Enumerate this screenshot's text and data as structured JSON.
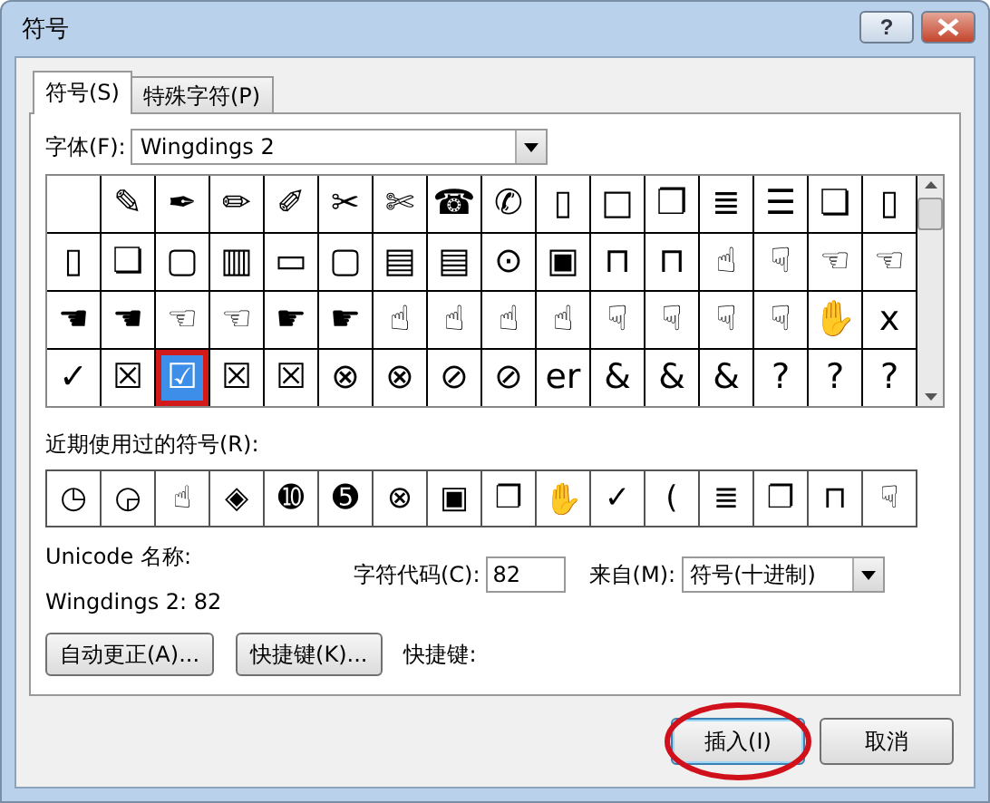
{
  "window": {
    "title": "符号",
    "help": "?"
  },
  "tabs": [
    {
      "label": "符号(S)",
      "selected": true
    },
    {
      "label": "特殊字符(P)",
      "selected": false
    }
  ],
  "font": {
    "label": "字体(F):",
    "value": "Wingdings 2"
  },
  "symbols": [
    [
      {
        "selected": false
      },
      {
        "glyph": "✎",
        "selected": false
      },
      {
        "glyph": "✒",
        "selected": false
      },
      {
        "glyph": "✏",
        "selected": false
      },
      {
        "glyph": "✐",
        "selected": false
      },
      {
        "glyph": "✂",
        "selected": false
      },
      {
        "glyph": "✄",
        "selected": false
      },
      {
        "glyph": "☎",
        "selected": false
      },
      {
        "glyph": "✆",
        "selected": false
      },
      {
        "glyph": "▯",
        "selected": false
      },
      {
        "glyph": "□",
        "selected": false
      },
      {
        "glyph": "❐",
        "selected": false
      },
      {
        "glyph": "≣",
        "selected": false
      },
      {
        "glyph": "☰",
        "selected": false
      },
      {
        "glyph": "❏",
        "selected": false
      },
      {
        "glyph": "▯",
        "selected": false
      }
    ],
    [
      {
        "glyph": "▯",
        "selected": false
      },
      {
        "glyph": "❏",
        "selected": false
      },
      {
        "glyph": "▢",
        "selected": false
      },
      {
        "glyph": "▥",
        "selected": false
      },
      {
        "glyph": "▭",
        "selected": false
      },
      {
        "glyph": "▢",
        "selected": false
      },
      {
        "glyph": "▤",
        "selected": false
      },
      {
        "glyph": "▤",
        "selected": false
      },
      {
        "glyph": "⊙",
        "selected": false
      },
      {
        "glyph": "▣",
        "selected": false
      },
      {
        "glyph": "⊓",
        "selected": false
      },
      {
        "glyph": "⊓",
        "selected": false
      },
      {
        "glyph": "☝",
        "selected": false
      },
      {
        "glyph": "☟",
        "selected": false
      },
      {
        "glyph": "☜",
        "selected": false
      },
      {
        "glyph": "☜",
        "selected": false
      }
    ],
    [
      {
        "glyph": "☚",
        "selected": false
      },
      {
        "glyph": "☚",
        "selected": false
      },
      {
        "glyph": "☜",
        "selected": false
      },
      {
        "glyph": "☜",
        "selected": false
      },
      {
        "glyph": "☛",
        "selected": false
      },
      {
        "glyph": "☛",
        "selected": false
      },
      {
        "glyph": "☝",
        "selected": false
      },
      {
        "glyph": "☝",
        "selected": false
      },
      {
        "glyph": "☝",
        "selected": false
      },
      {
        "glyph": "☝",
        "selected": false
      },
      {
        "glyph": "☟",
        "selected": false
      },
      {
        "glyph": "☟",
        "selected": false
      },
      {
        "glyph": "☟",
        "selected": false
      },
      {
        "glyph": "☟",
        "selected": false
      },
      {
        "glyph": "✋",
        "selected": false
      },
      {
        "glyph": "x",
        "selected": false
      }
    ],
    [
      {
        "glyph": "✓",
        "selected": false
      },
      {
        "glyph": "☒",
        "selected": false
      },
      {
        "glyph": "☑",
        "selected": true
      },
      {
        "glyph": "☒",
        "selected": false
      },
      {
        "glyph": "☒",
        "selected": false
      },
      {
        "glyph": "⊗",
        "selected": false
      },
      {
        "glyph": "⊗",
        "selected": false
      },
      {
        "glyph": "⊘",
        "selected": false
      },
      {
        "glyph": "⊘",
        "selected": false
      },
      {
        "glyph": "er",
        "selected": false
      },
      {
        "glyph": "&",
        "selected": false
      },
      {
        "glyph": "&",
        "selected": false
      },
      {
        "glyph": "&",
        "selected": false
      },
      {
        "glyph": "?",
        "selected": false
      },
      {
        "glyph": "?",
        "selected": false
      },
      {
        "glyph": "?",
        "selected": false
      }
    ]
  ],
  "recent": {
    "label": "近期使用过的符号(R):",
    "glyphs": [
      "◷",
      "◶",
      "☝",
      "◈",
      "➓",
      "➎",
      "⊗",
      "▣",
      "❐",
      "✋",
      "✓",
      "(",
      "≣",
      "❐",
      "⊓",
      "☟"
    ]
  },
  "unicode_name": {
    "label": "Unicode 名称:",
    "value": "Wingdings 2: 82"
  },
  "char_code": {
    "label": "字符代码(C):",
    "value": "82"
  },
  "from": {
    "label": "来自(M):",
    "value": "符号(十进制)"
  },
  "tool_buttons": [
    "自动更正(A)...",
    "快捷键(K)..."
  ],
  "shortcut_label": "快捷键:",
  "buttons": [
    {
      "label": "插入(I)",
      "kind": "default",
      "circled": true
    },
    {
      "label": "取消",
      "kind": "normal",
      "circled": false
    }
  ]
}
